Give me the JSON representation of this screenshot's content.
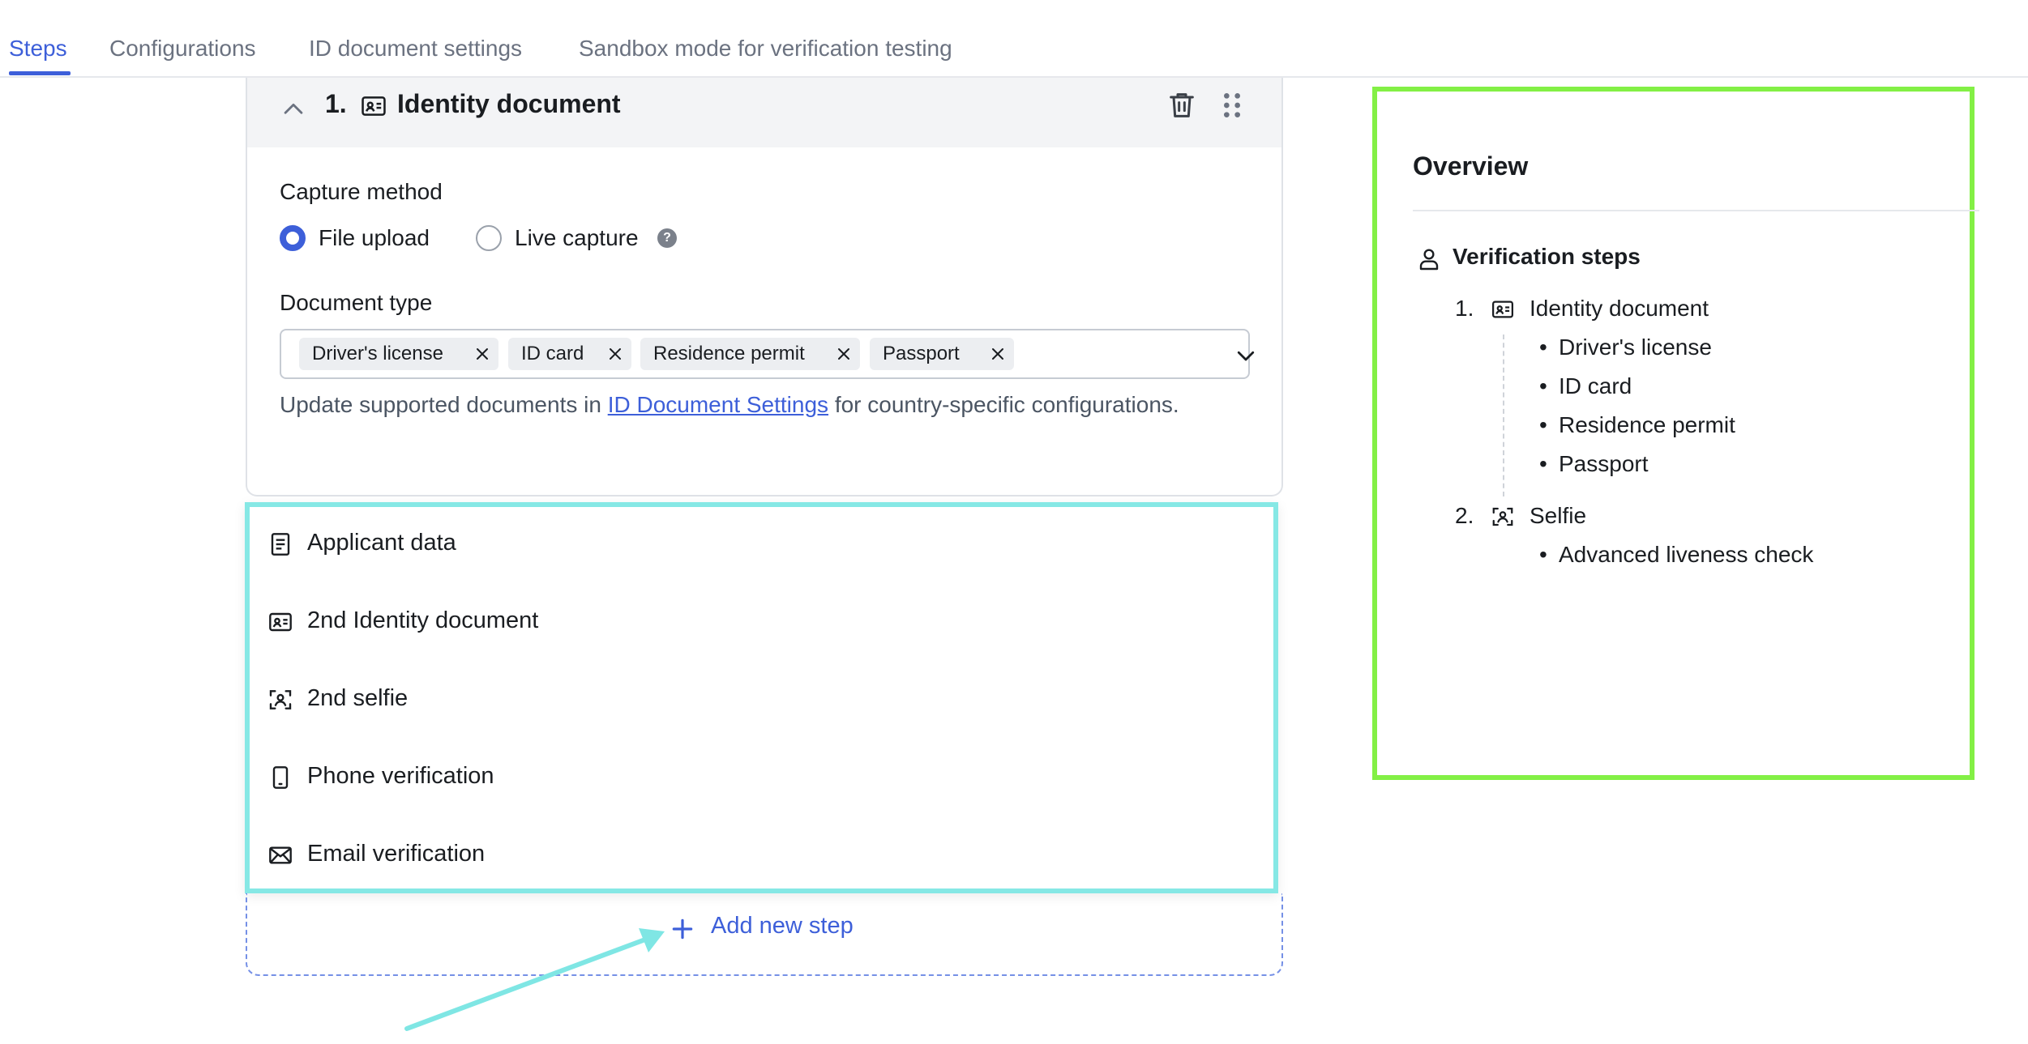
{
  "tabs": [
    {
      "label": "Steps",
      "active": true
    },
    {
      "label": "Configurations",
      "active": false
    },
    {
      "label": "ID document settings",
      "active": false
    },
    {
      "label": "Sandbox mode for verification testing",
      "active": false
    }
  ],
  "step": {
    "number": "1.",
    "title": "Identity document",
    "capture_method_label": "Capture method",
    "capture_options": [
      {
        "label": "File upload",
        "selected": true
      },
      {
        "label": "Live capture",
        "selected": false
      }
    ],
    "help_glyph": "?",
    "document_type_label": "Document type",
    "document_types": [
      "Driver's license",
      "ID card",
      "Residence permit",
      "Passport"
    ],
    "hint_prefix": "Update supported documents in ",
    "hint_link": "ID Document Settings",
    "hint_suffix": " for country-specific configurations."
  },
  "menu": {
    "items": [
      {
        "label": "Applicant data",
        "icon": "document-icon"
      },
      {
        "label": "2nd Identity document",
        "icon": "id-card-icon"
      },
      {
        "label": "2nd selfie",
        "icon": "selfie-icon"
      },
      {
        "label": "Phone verification",
        "icon": "phone-icon"
      },
      {
        "label": "Email verification",
        "icon": "email-icon"
      }
    ]
  },
  "add_step": {
    "label": "Add new step"
  },
  "overview": {
    "title": "Overview",
    "section": "Verification steps",
    "steps": [
      {
        "number": "1.",
        "title": "Identity document",
        "icon": "id-card-icon",
        "items": [
          "Driver's license",
          "ID card",
          "Residence permit",
          "Passport"
        ]
      },
      {
        "number": "2.",
        "title": "Selfie",
        "icon": "selfie-icon",
        "items": [
          "Advanced liveness check"
        ]
      }
    ]
  },
  "colors": {
    "accent": "#3d5fd9",
    "menu_highlight": "#86e8e5",
    "overview_highlight": "#83f045",
    "annotation_arrow": "#7fe6e4"
  }
}
